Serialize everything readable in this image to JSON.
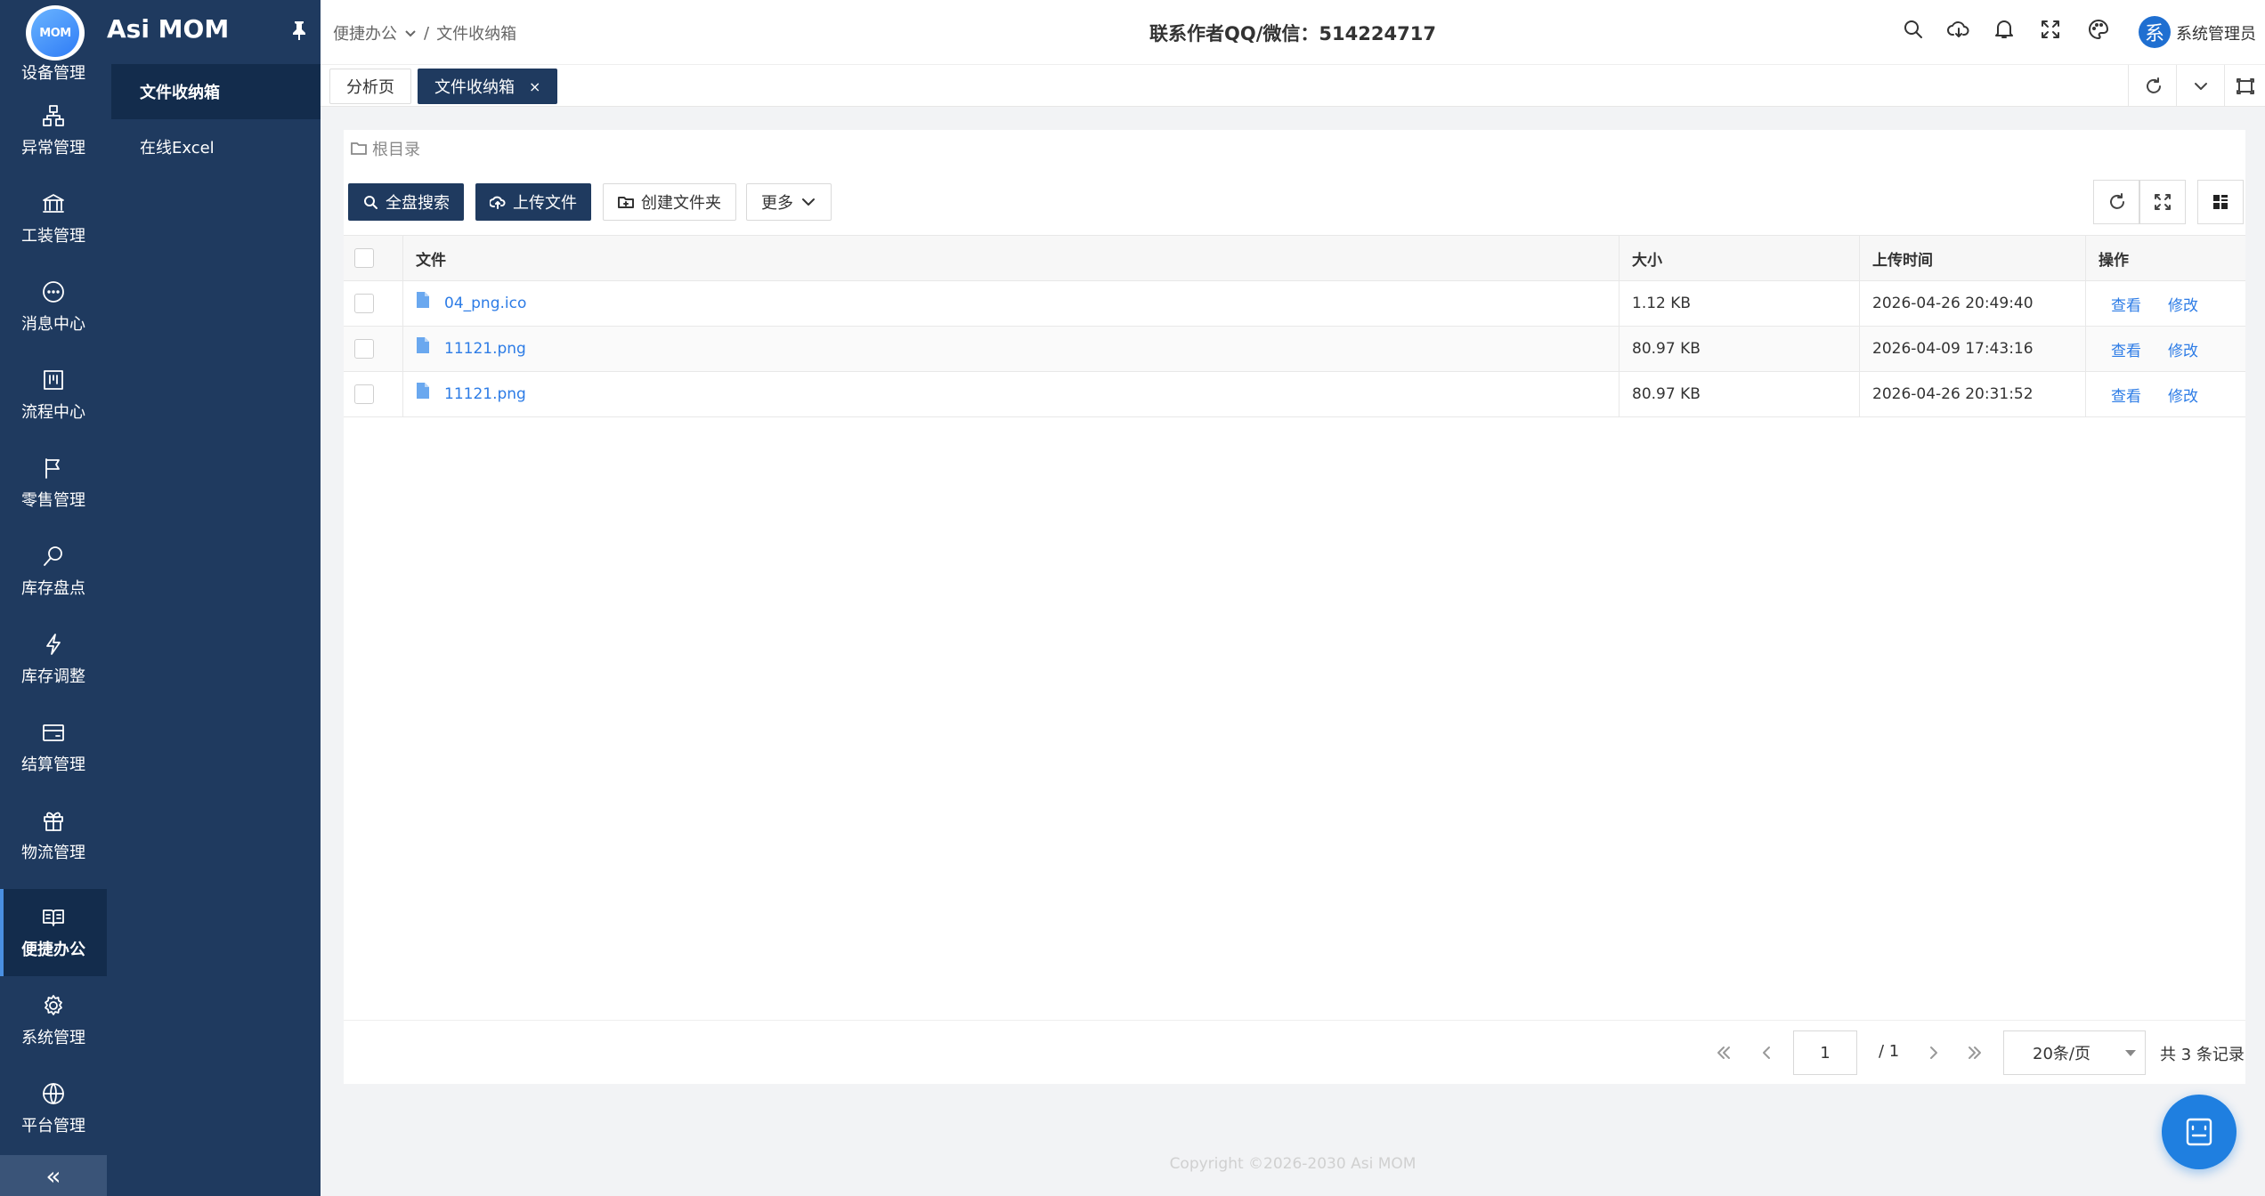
{
  "app": {
    "logo_text": "MOM",
    "title": "Asi MOM",
    "top_nav_label": "设备管理"
  },
  "nav": {
    "items": [
      {
        "label": "异常管理",
        "icon": "sitemap-icon"
      },
      {
        "label": "工装管理",
        "icon": "bank-icon"
      },
      {
        "label": "消息中心",
        "icon": "message-icon"
      },
      {
        "label": "流程中心",
        "icon": "board-icon"
      },
      {
        "label": "零售管理",
        "icon": "flag-icon"
      },
      {
        "label": "库存盘点",
        "icon": "search-icon"
      },
      {
        "label": "库存调整",
        "icon": "lightning-icon"
      },
      {
        "label": "结算管理",
        "icon": "wallet-icon"
      },
      {
        "label": "物流管理",
        "icon": "gift-icon"
      },
      {
        "label": "便捷办公",
        "icon": "book-icon",
        "active": true
      },
      {
        "label": "系统管理",
        "icon": "gear-icon"
      },
      {
        "label": "平台管理",
        "icon": "globe-icon"
      }
    ],
    "collapse_label": "«"
  },
  "submenu": {
    "items": [
      {
        "label": "文件收纳箱",
        "active": true
      },
      {
        "label": "在线Excel",
        "active": false
      }
    ]
  },
  "header": {
    "breadcrumb": [
      "便捷办公",
      "/",
      "文件收纳箱"
    ],
    "contact": "联系作者QQ/微信：514224717",
    "user_avatar": "系",
    "user_name": "系统管理员"
  },
  "tabs": [
    {
      "label": "分析页",
      "active": false
    },
    {
      "label": "文件收纳箱",
      "active": true,
      "close": "×"
    }
  ],
  "toolbar": {
    "root_dir": "根目录",
    "search_label": "全盘搜索",
    "upload_label": "上传文件",
    "create_folder_label": "创建文件夹",
    "more_label": "更多"
  },
  "table": {
    "columns": [
      "文件",
      "大小",
      "上传时间",
      "操作"
    ],
    "rows": [
      {
        "name": "04_png.ico",
        "size": "1.12 KB",
        "time": "2026-04-26 20:49:40",
        "view": "查看",
        "edit": "修改"
      },
      {
        "name": "11121.png",
        "size": "80.97 KB",
        "time": "2026-04-09 17:43:16",
        "view": "查看",
        "edit": "修改"
      },
      {
        "name": "11121.png",
        "size": "80.97 KB",
        "time": "2026-04-26 20:31:52",
        "view": "查看",
        "edit": "修改"
      }
    ]
  },
  "pager": {
    "current_page": "1",
    "total_pages": "/ 1",
    "page_size": "20条/页",
    "records": "共 3 条记录"
  },
  "footer": {
    "copyright": "Copyright ©2026-2030 Asi MOM"
  },
  "colors": {
    "sidebar": "#1f3a5f",
    "active": "#132c4c",
    "link": "#2d7ce6",
    "fab": "#1f7fe0"
  }
}
